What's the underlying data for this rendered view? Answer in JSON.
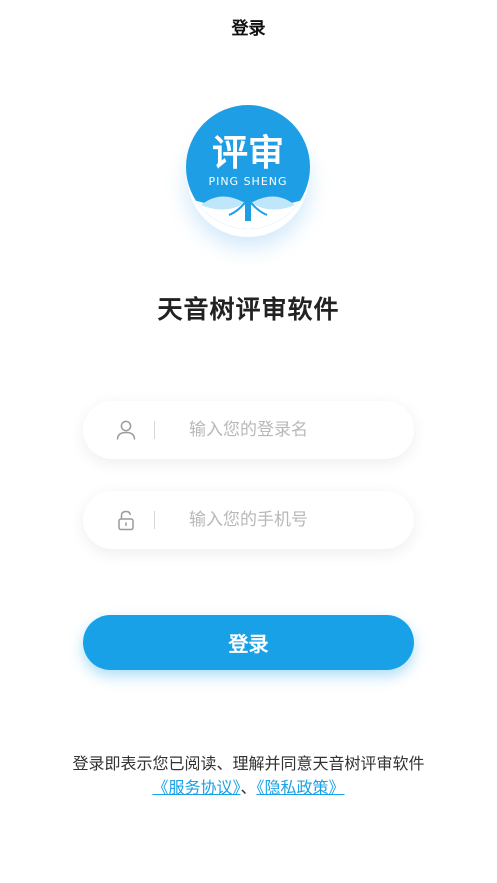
{
  "header": {
    "title": "登录"
  },
  "logo": {
    "main_text": "评审",
    "sub_text": "PING SHENG"
  },
  "app_name": "天音树评审软件",
  "form": {
    "username": {
      "placeholder": "输入您的登录名",
      "value": ""
    },
    "password": {
      "placeholder": "输入您的手机号",
      "value": ""
    },
    "login_label": "登录"
  },
  "agreement": {
    "text": "登录即表示您已阅读、理解并同意天音树评审软件",
    "service_link": "《服务协议》",
    "separator": "、",
    "privacy_link": "《隐私政策》"
  },
  "icons": {
    "username": "user-icon",
    "password": "lock-icon"
  },
  "colors": {
    "accent": "#18a1e6",
    "text": "#222222",
    "placeholder": "#b8b8b8"
  }
}
